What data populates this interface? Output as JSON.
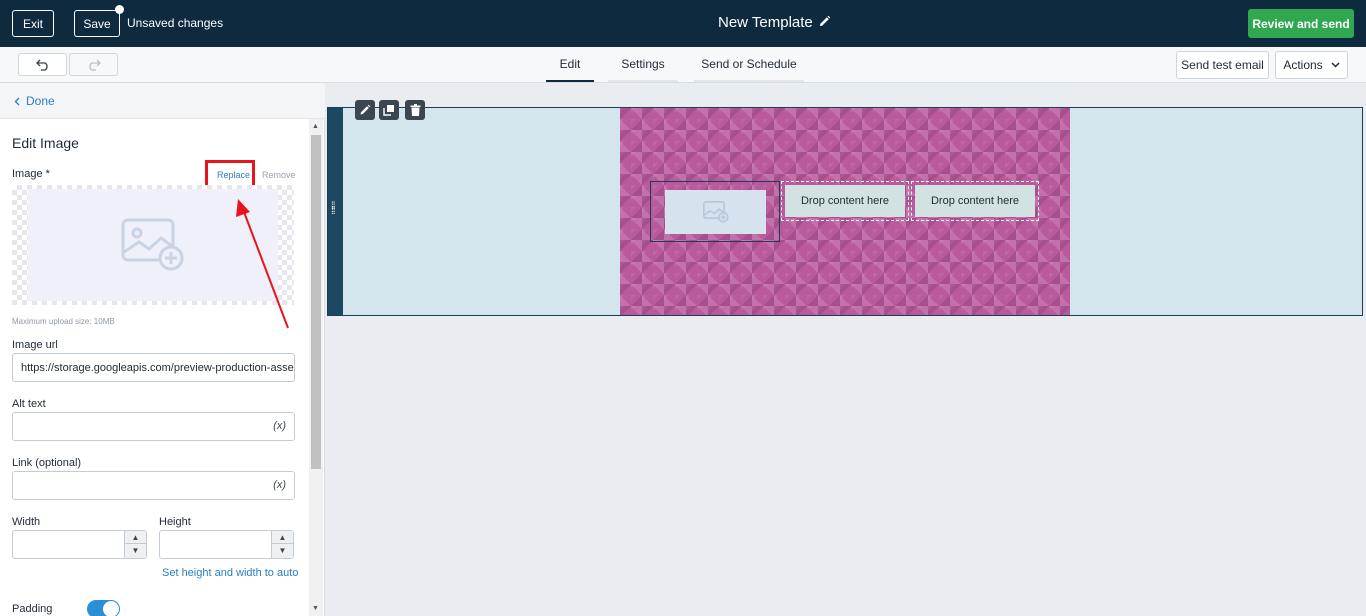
{
  "header": {
    "exit_label": "Exit",
    "save_label": "Save",
    "unsaved_label": "Unsaved changes",
    "template_title": "New Template",
    "review_label": "Review and send"
  },
  "toolbar": {
    "tabs": [
      {
        "label": "Edit",
        "active": true
      },
      {
        "label": "Settings",
        "active": false
      },
      {
        "label": "Send or Schedule",
        "active": false
      }
    ],
    "send_test_label": "Send test email",
    "actions_label": "Actions"
  },
  "panel": {
    "done_label": "Done",
    "title": "Edit Image",
    "image_label": "Image *",
    "replace_label": "Replace",
    "remove_label": "Remove",
    "upload_note": "Maximum upload size: 10MB",
    "image_url_label": "Image url",
    "image_url_value": "https://storage.googleapis.com/preview-production-asse",
    "alt_text_label": "Alt text",
    "alt_text_value": "",
    "link_label": "Link (optional)",
    "link_value": "",
    "variable_icon_text": "(x)",
    "width_label": "Width",
    "height_label": "Height",
    "auto_size_label": "Set height and width to auto",
    "padding_label": "Padding",
    "padding_on": true
  },
  "canvas": {
    "drop_zone_1": "Drop content here",
    "drop_zone_2": "Drop content here"
  },
  "colors": {
    "topbar": "#0e2a3f",
    "accent_green": "#2fa84f",
    "link_blue": "#2a7ec2",
    "highlight_red": "#e8141b",
    "pattern_magenta": "#b85a9c"
  },
  "icons": [
    "undo-icon",
    "redo-icon",
    "pencil-icon",
    "chevron-down-icon",
    "chevron-left-icon",
    "image-add-icon",
    "edit-icon",
    "duplicate-icon",
    "trash-icon",
    "drag-handle-icon",
    "spin-up-icon",
    "spin-down-icon"
  ]
}
